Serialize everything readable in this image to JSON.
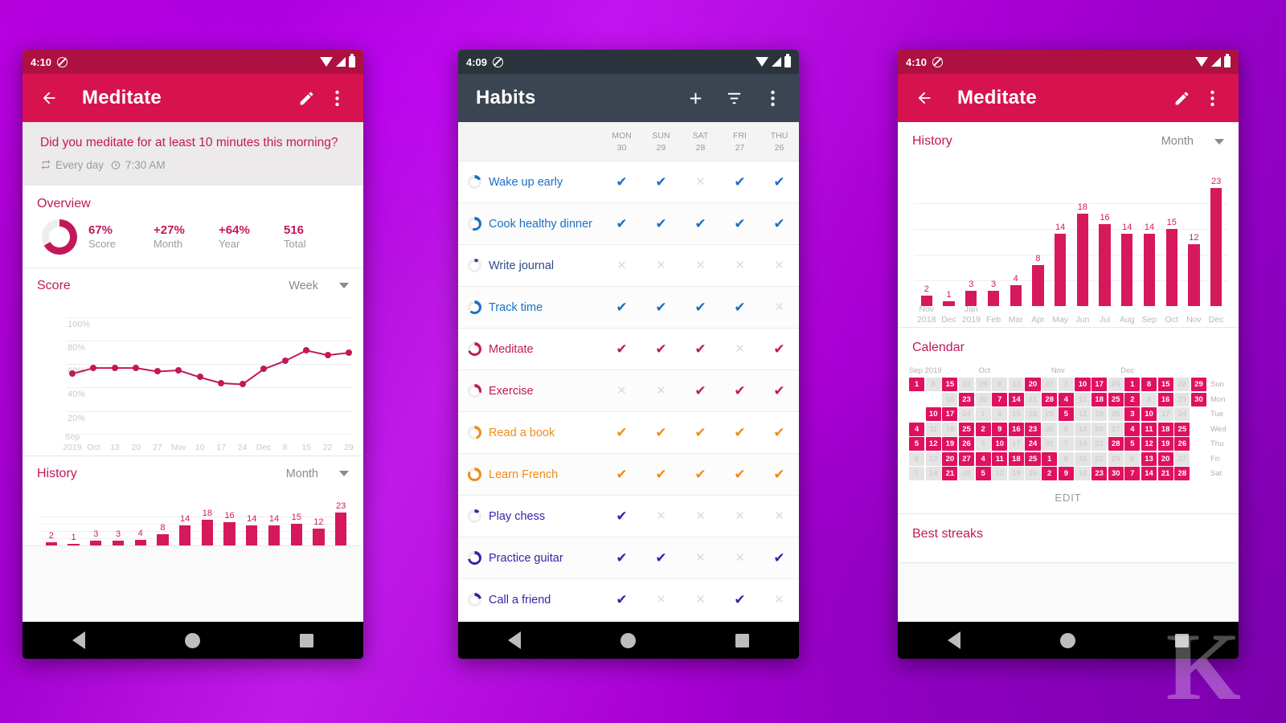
{
  "colors": {
    "accent_red": "#d6134f",
    "status_red": "#ad1041",
    "dark_toolbar": "#3b4552",
    "pink": "#c2185b",
    "calendar_on": "#e0115f",
    "blue": "#1976d2",
    "orange": "#ef8c1a",
    "purple": "#3b1fa8"
  },
  "phone1": {
    "status": {
      "time": "4:10",
      "dnd_icon": "do-not-disturb-icon",
      "wifi_icon": "wifi-icon",
      "signal_icon": "signal-icon",
      "battery_icon": "battery-icon"
    },
    "appbar": {
      "back_icon": "back-arrow-icon",
      "title": "Meditate",
      "edit_icon": "pencil-icon",
      "overflow_icon": "overflow-menu-icon"
    },
    "question": {
      "text": "Did you meditate for at least 10 minutes this morning?",
      "repeat_icon": "repeat-icon",
      "repeat_label": "Every day",
      "alarm_icon": "alarm-icon",
      "alarm_label": "7:30 AM"
    },
    "overview": {
      "title": "Overview",
      "donut_icon": "score-donut-icon",
      "donut_percent": 67,
      "stats": [
        {
          "value": "67%",
          "label": "Score"
        },
        {
          "value": "+27%",
          "label": "Month"
        },
        {
          "value": "+64%",
          "label": "Year"
        },
        {
          "value": "516",
          "label": "Total"
        }
      ]
    },
    "score": {
      "title": "Score",
      "range": "Week",
      "caret_icon": "chevron-down-icon"
    },
    "history": {
      "title": "History",
      "range": "Month",
      "caret_icon": "chevron-down-icon"
    },
    "nav": {
      "back_icon": "nav-back-icon",
      "home_icon": "nav-home-icon",
      "recents_icon": "nav-recents-icon"
    }
  },
  "phone2": {
    "status": {
      "time": "4:09",
      "dnd_icon": "do-not-disturb-icon",
      "wifi_icon": "wifi-icon",
      "signal_icon": "signal-icon",
      "battery_icon": "battery-icon"
    },
    "appbar": {
      "title": "Habits",
      "add_icon": "plus-icon",
      "filter_icon": "filter-icon",
      "overflow_icon": "overflow-menu-icon"
    },
    "day_columns": [
      {
        "dow": "MON",
        "num": "30"
      },
      {
        "dow": "SUN",
        "num": "29"
      },
      {
        "dow": "SAT",
        "num": "28"
      },
      {
        "dow": "FRI",
        "num": "27"
      },
      {
        "dow": "THU",
        "num": "26"
      }
    ],
    "check_glyph": "✔",
    "cross_glyph": "✕",
    "habits": [
      {
        "name": "Wake up early",
        "color": "#1b6fc4",
        "ring_pct": 18,
        "marks": [
          1,
          1,
          0,
          1,
          1
        ]
      },
      {
        "name": "Cook healthy dinner",
        "color": "#1b6fc4",
        "ring_pct": 55,
        "marks": [
          1,
          1,
          1,
          1,
          1
        ]
      },
      {
        "name": "Write journal",
        "color": "#2d4a8a",
        "ring_pct": 10,
        "marks": [
          0,
          0,
          0,
          0,
          0
        ]
      },
      {
        "name": "Track time",
        "color": "#1b6fc4",
        "ring_pct": 62,
        "marks": [
          1,
          1,
          1,
          1,
          0
        ]
      },
      {
        "name": "Meditate",
        "color": "#c2185b",
        "ring_pct": 70,
        "marks": [
          1,
          1,
          1,
          0,
          1
        ]
      },
      {
        "name": "Exercise",
        "color": "#c2185b",
        "ring_pct": 30,
        "marks": [
          0,
          0,
          1,
          1,
          1
        ]
      },
      {
        "name": "Read a book",
        "color": "#ef8c1a",
        "ring_pct": 45,
        "marks": [
          1,
          1,
          1,
          1,
          1
        ]
      },
      {
        "name": "Learn French",
        "color": "#ef8c1a",
        "ring_pct": 82,
        "marks": [
          1,
          1,
          1,
          1,
          1
        ]
      },
      {
        "name": "Play chess",
        "color": "#3b1fa8",
        "ring_pct": 12,
        "marks": [
          1,
          0,
          0,
          0,
          0
        ]
      },
      {
        "name": "Practice guitar",
        "color": "#3b1fa8",
        "ring_pct": 72,
        "marks": [
          1,
          1,
          0,
          0,
          1
        ]
      },
      {
        "name": "Call a friend",
        "color": "#3b1fa8",
        "ring_pct": 22,
        "marks": [
          1,
          0,
          0,
          1,
          0
        ]
      }
    ],
    "nav": {
      "back_icon": "nav-back-icon",
      "home_icon": "nav-home-icon",
      "recents_icon": "nav-recents-icon"
    }
  },
  "phone3": {
    "status": {
      "time": "4:10",
      "dnd_icon": "do-not-disturb-icon",
      "wifi_icon": "wifi-icon",
      "signal_icon": "signal-icon",
      "battery_icon": "battery-icon"
    },
    "appbar": {
      "back_icon": "back-arrow-icon",
      "title": "Meditate",
      "edit_icon": "pencil-icon",
      "overflow_icon": "overflow-menu-icon"
    },
    "history": {
      "title": "History",
      "range": "Month",
      "caret_icon": "chevron-down-icon"
    },
    "calendar": {
      "title": "Calendar",
      "edit_label": "EDIT",
      "month_labels": [
        "Sep 2019",
        "Oct",
        "Nov",
        "Dec"
      ],
      "weekday_labels": [
        "Sun",
        "Mon",
        "Tue",
        "Wed",
        "Thu",
        "Fri",
        "Sat"
      ],
      "columns": [
        {
          "cells": [
            {
              "n": "1",
              "on": true
            },
            {
              "n": "",
              "on": null
            },
            {
              "n": "",
              "on": null
            },
            {
              "n": "4",
              "on": true
            },
            {
              "n": "5",
              "on": true
            },
            {
              "n": "6",
              "on": false
            },
            {
              "n": "7",
              "on": false
            }
          ]
        },
        {
          "cells": [
            {
              "n": "8",
              "on": false
            },
            {
              "n": "",
              "on": null
            },
            {
              "n": "10",
              "on": true
            },
            {
              "n": "11",
              "on": false
            },
            {
              "n": "12",
              "on": true
            },
            {
              "n": "13",
              "on": false
            },
            {
              "n": "14",
              "on": false
            }
          ]
        },
        {
          "cells": [
            {
              "n": "15",
              "on": true
            },
            {
              "n": "16",
              "on": false
            },
            {
              "n": "17",
              "on": true
            },
            {
              "n": "18",
              "on": false
            },
            {
              "n": "19",
              "on": true
            },
            {
              "n": "20",
              "on": true
            },
            {
              "n": "21",
              "on": true
            }
          ]
        },
        {
          "cells": [
            {
              "n": "22",
              "on": false
            },
            {
              "n": "23",
              "on": true
            },
            {
              "n": "24",
              "on": false
            },
            {
              "n": "25",
              "on": true
            },
            {
              "n": "26",
              "on": true
            },
            {
              "n": "27",
              "on": true
            },
            {
              "n": "28",
              "on": false
            }
          ]
        },
        {
          "cells": [
            {
              "n": "29",
              "on": false
            },
            {
              "n": "30",
              "on": false
            },
            {
              "n": "1",
              "on": false
            },
            {
              "n": "2",
              "on": true
            },
            {
              "n": "3",
              "on": false
            },
            {
              "n": "4",
              "on": true
            },
            {
              "n": "5",
              "on": true
            }
          ]
        },
        {
          "cells": [
            {
              "n": "6",
              "on": false
            },
            {
              "n": "7",
              "on": true
            },
            {
              "n": "8",
              "on": false
            },
            {
              "n": "9",
              "on": true
            },
            {
              "n": "10",
              "on": true
            },
            {
              "n": "11",
              "on": true
            },
            {
              "n": "12",
              "on": false
            }
          ]
        },
        {
          "cells": [
            {
              "n": "13",
              "on": false
            },
            {
              "n": "14",
              "on": true
            },
            {
              "n": "15",
              "on": false
            },
            {
              "n": "16",
              "on": true
            },
            {
              "n": "17",
              "on": false
            },
            {
              "n": "18",
              "on": true
            },
            {
              "n": "19",
              "on": false
            }
          ]
        },
        {
          "cells": [
            {
              "n": "20",
              "on": true
            },
            {
              "n": "21",
              "on": false
            },
            {
              "n": "22",
              "on": false
            },
            {
              "n": "23",
              "on": true
            },
            {
              "n": "24",
              "on": true
            },
            {
              "n": "25",
              "on": true
            },
            {
              "n": "26",
              "on": false
            }
          ]
        },
        {
          "cells": [
            {
              "n": "27",
              "on": false
            },
            {
              "n": "28",
              "on": true
            },
            {
              "n": "29",
              "on": false
            },
            {
              "n": "30",
              "on": false
            },
            {
              "n": "31",
              "on": false
            },
            {
              "n": "1",
              "on": true
            },
            {
              "n": "2",
              "on": true
            }
          ]
        },
        {
          "cells": [
            {
              "n": "3",
              "on": false
            },
            {
              "n": "4",
              "on": true
            },
            {
              "n": "5",
              "on": true
            },
            {
              "n": "6",
              "on": false
            },
            {
              "n": "7",
              "on": false
            },
            {
              "n": "8",
              "on": false
            },
            {
              "n": "9",
              "on": true
            }
          ]
        },
        {
          "cells": [
            {
              "n": "10",
              "on": true
            },
            {
              "n": "11",
              "on": false
            },
            {
              "n": "12",
              "on": false
            },
            {
              "n": "13",
              "on": false
            },
            {
              "n": "14",
              "on": false
            },
            {
              "n": "15",
              "on": false
            },
            {
              "n": "16",
              "on": false
            }
          ]
        },
        {
          "cells": [
            {
              "n": "17",
              "on": true
            },
            {
              "n": "18",
              "on": true
            },
            {
              "n": "19",
              "on": false
            },
            {
              "n": "20",
              "on": false
            },
            {
              "n": "21",
              "on": false
            },
            {
              "n": "22",
              "on": false
            },
            {
              "n": "23",
              "on": true
            }
          ]
        },
        {
          "cells": [
            {
              "n": "24",
              "on": false
            },
            {
              "n": "25",
              "on": true
            },
            {
              "n": "26",
              "on": false
            },
            {
              "n": "27",
              "on": false
            },
            {
              "n": "28",
              "on": true
            },
            {
              "n": "29",
              "on": false
            },
            {
              "n": "30",
              "on": true
            }
          ]
        },
        {
          "cells": [
            {
              "n": "1",
              "on": true
            },
            {
              "n": "2",
              "on": true
            },
            {
              "n": "3",
              "on": true
            },
            {
              "n": "4",
              "on": true
            },
            {
              "n": "5",
              "on": true
            },
            {
              "n": "6",
              "on": false
            },
            {
              "n": "7",
              "on": true
            }
          ]
        },
        {
          "cells": [
            {
              "n": "8",
              "on": true
            },
            {
              "n": "9",
              "on": false
            },
            {
              "n": "10",
              "on": true
            },
            {
              "n": "11",
              "on": true
            },
            {
              "n": "12",
              "on": true
            },
            {
              "n": "13",
              "on": true
            },
            {
              "n": "14",
              "on": true
            }
          ]
        },
        {
          "cells": [
            {
              "n": "15",
              "on": true
            },
            {
              "n": "16",
              "on": true
            },
            {
              "n": "17",
              "on": false
            },
            {
              "n": "18",
              "on": true
            },
            {
              "n": "19",
              "on": true
            },
            {
              "n": "20",
              "on": true
            },
            {
              "n": "21",
              "on": true
            }
          ]
        },
        {
          "cells": [
            {
              "n": "22",
              "on": false
            },
            {
              "n": "23",
              "on": false
            },
            {
              "n": "24",
              "on": false
            },
            {
              "n": "25",
              "on": true
            },
            {
              "n": "26",
              "on": true
            },
            {
              "n": "27",
              "on": false
            },
            {
              "n": "28",
              "on": true
            }
          ]
        },
        {
          "cells": [
            {
              "n": "29",
              "on": true
            },
            {
              "n": "30",
              "on": true
            },
            {
              "n": "",
              "on": null
            },
            {
              "n": "",
              "on": null
            },
            {
              "n": "",
              "on": null
            },
            {
              "n": "",
              "on": null
            },
            {
              "n": "",
              "on": null
            }
          ]
        }
      ]
    },
    "best_streaks": {
      "title": "Best streaks"
    },
    "nav": {
      "back_icon": "nav-back-icon",
      "home_icon": "nav-home-icon",
      "recents_icon": "nav-recents-icon"
    }
  },
  "chart_data": [
    {
      "type": "line",
      "title": "Score",
      "xlabel": "",
      "ylabel": "",
      "ylim": [
        0,
        110
      ],
      "grid": true,
      "ytick_labels": [
        "20%",
        "40%",
        "60%",
        "80%",
        "100%"
      ],
      "ytick_values": [
        20,
        40,
        60,
        80,
        100
      ],
      "x": [
        "Sep 2019",
        "Oct",
        "13",
        "20",
        "27",
        "Nov",
        "10",
        "17",
        "24",
        "Dec",
        "8",
        "15",
        "22",
        "29"
      ],
      "values": [
        52,
        57,
        57,
        57,
        54,
        55,
        49,
        44,
        43,
        56,
        63,
        72,
        68,
        70
      ],
      "series_color": "#c2185b",
      "range_selector": "Week"
    },
    {
      "type": "bar",
      "title": "History",
      "xlabel": "",
      "ylabel": "",
      "ylim": [
        0,
        25
      ],
      "grid": true,
      "categories": [
        "Nov 2018",
        "Dec",
        "Jan 2019",
        "Feb",
        "Mar",
        "Apr",
        "May",
        "Jun",
        "Jul",
        "Aug",
        "Sep",
        "Oct",
        "Nov",
        "Dec"
      ],
      "values": [
        2,
        1,
        3,
        3,
        4,
        8,
        14,
        18,
        16,
        14,
        14,
        15,
        12,
        23
      ],
      "series_color": "#d6185c",
      "range_selector": "Month"
    }
  ],
  "watermark": "K"
}
